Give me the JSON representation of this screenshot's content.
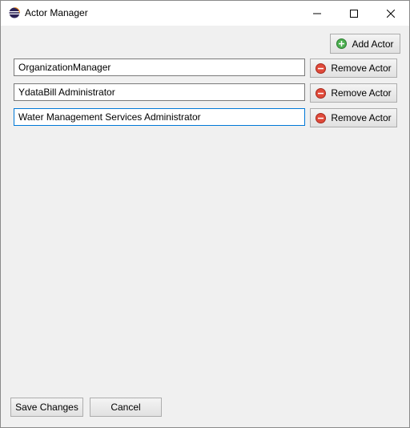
{
  "window": {
    "title": "Actor Manager"
  },
  "toolbar": {
    "add_label": "Add Actor"
  },
  "actors": [
    {
      "name": "OrganizationManager",
      "remove_label": "Remove Actor"
    },
    {
      "name": "YdataBill Administrator",
      "remove_label": "Remove Actor"
    },
    {
      "name": "Water Management Services Administrator",
      "remove_label": "Remove Actor"
    }
  ],
  "footer": {
    "save_label": "Save Changes",
    "cancel_label": "Cancel"
  },
  "icons": {
    "add": "plus-circle-icon",
    "remove": "minus-circle-icon"
  },
  "colors": {
    "add_icon": "#4caf50",
    "remove_icon": "#e04a3a",
    "focus_border": "#0078d7"
  }
}
